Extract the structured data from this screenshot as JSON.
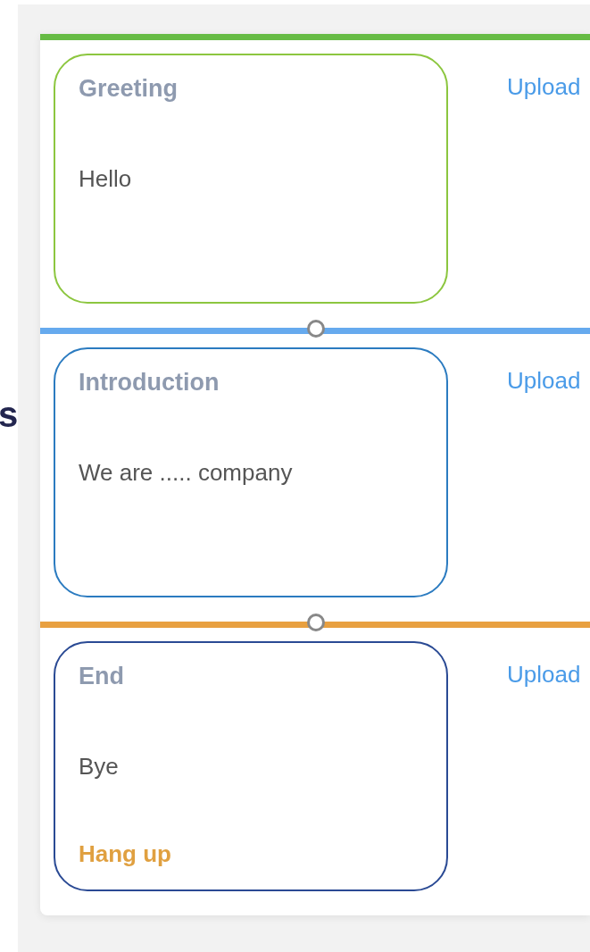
{
  "side_label": "s",
  "steps": [
    {
      "title": "Greeting",
      "text": "Hello",
      "color": "#8cc63f",
      "bar": {
        "color": "#66bb44",
        "handle": false
      },
      "upload": "Upload"
    },
    {
      "title": "Introduction",
      "text": "We are ..... company",
      "color": "#2b7bc0",
      "bar": {
        "color": "#66aaee",
        "handle": true
      },
      "upload": "Upload"
    },
    {
      "title": "End",
      "text": "Bye",
      "color": "#2a4a94",
      "bar": {
        "color": "#e8a040",
        "handle": true
      },
      "upload": "Upload",
      "action": "Hang up"
    }
  ]
}
